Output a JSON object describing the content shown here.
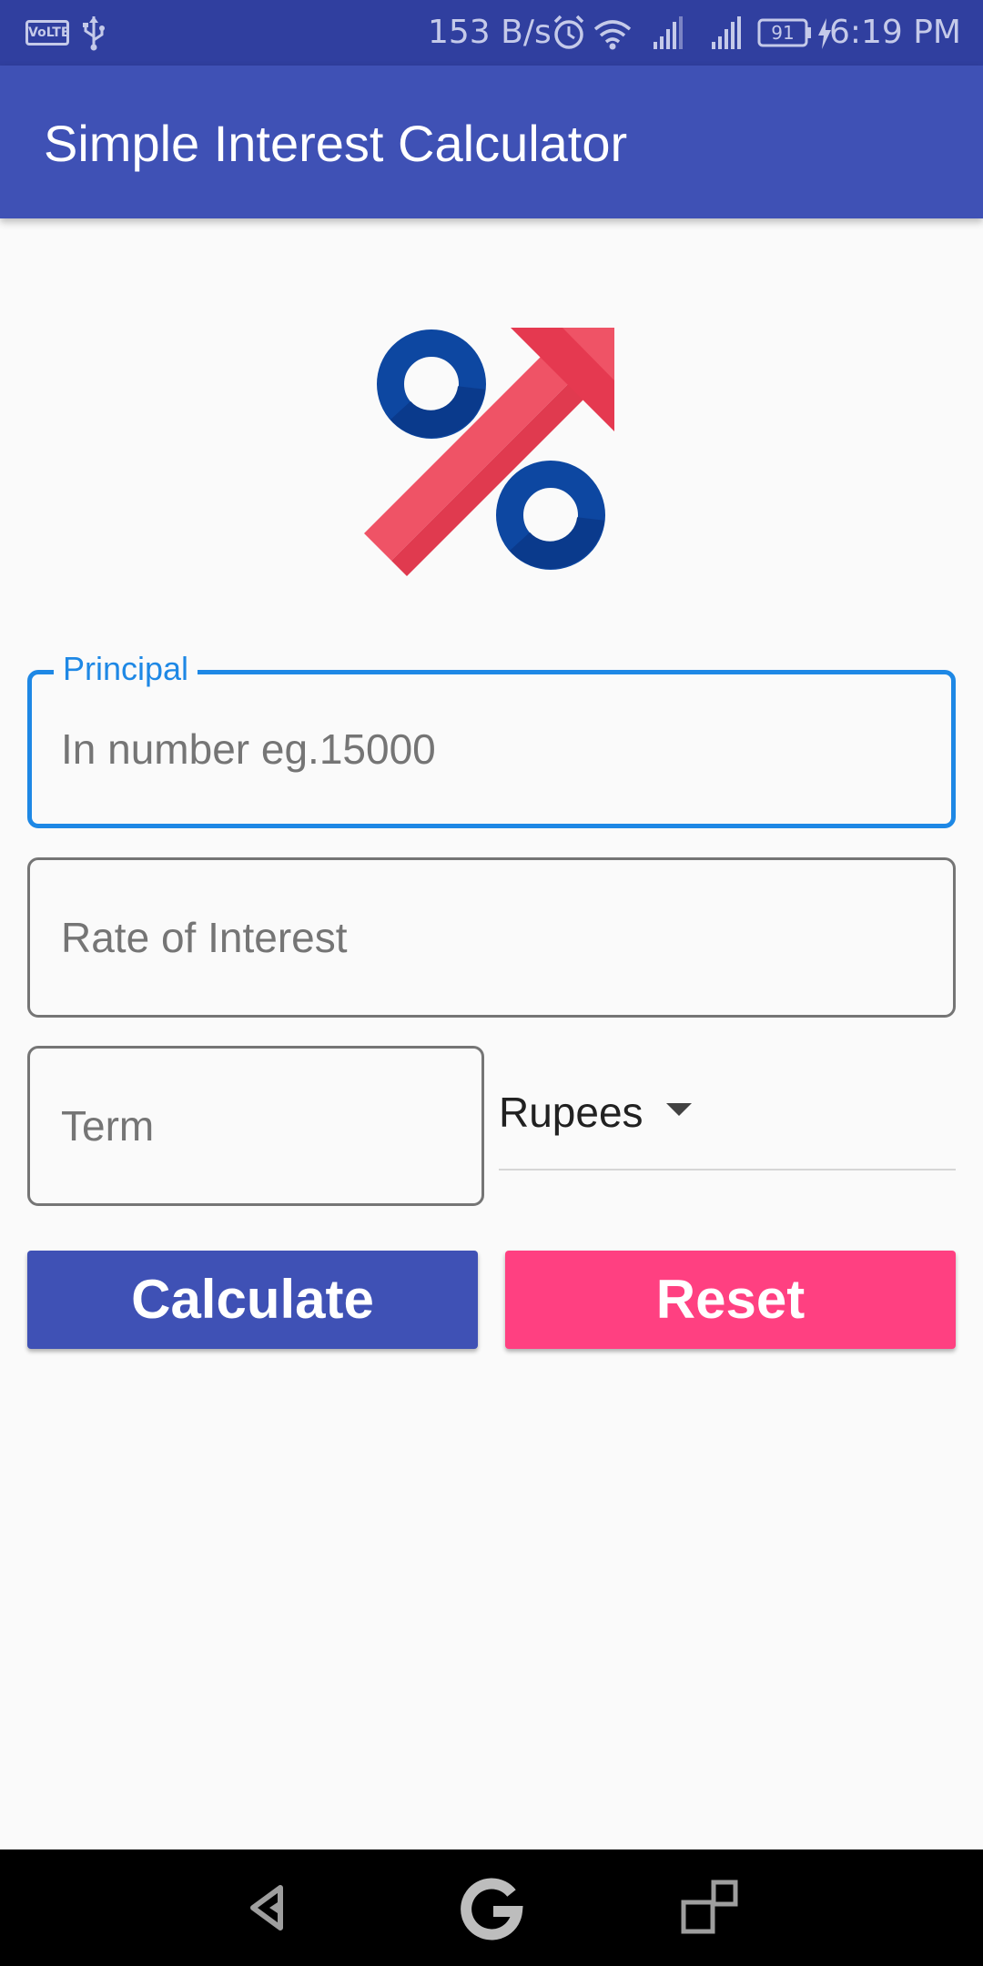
{
  "status_bar": {
    "volte": "VoLTE",
    "speed": "153 B/s",
    "battery": "91",
    "time": "6:19 PM",
    "icons": [
      "usb-icon",
      "alarm-icon",
      "wifi-icon",
      "signal-icon",
      "signal-icon",
      "battery-icon",
      "charging-icon"
    ]
  },
  "app_bar": {
    "title": "Simple Interest Calculator"
  },
  "logo": {
    "icon": "percent-growth-icon",
    "colors": {
      "circle": "#0d47a1",
      "arrow": "#ef5366"
    }
  },
  "form": {
    "principal": {
      "label": "Principal",
      "placeholder": "In number eg.15000",
      "value": ""
    },
    "rate": {
      "placeholder": "Rate of Interest",
      "value": ""
    },
    "term": {
      "placeholder": "Term",
      "value": ""
    },
    "currency": {
      "selected": "Rupees"
    }
  },
  "buttons": {
    "calculate": "Calculate",
    "reset": "Reset"
  },
  "colors": {
    "primary": "#3f51b5",
    "primary_dark": "#303f9f",
    "accent": "#ff4081",
    "focus": "#1e88e5"
  },
  "nav_bar": {
    "icons": [
      "back-icon",
      "home-icon",
      "recent-apps-icon"
    ]
  }
}
